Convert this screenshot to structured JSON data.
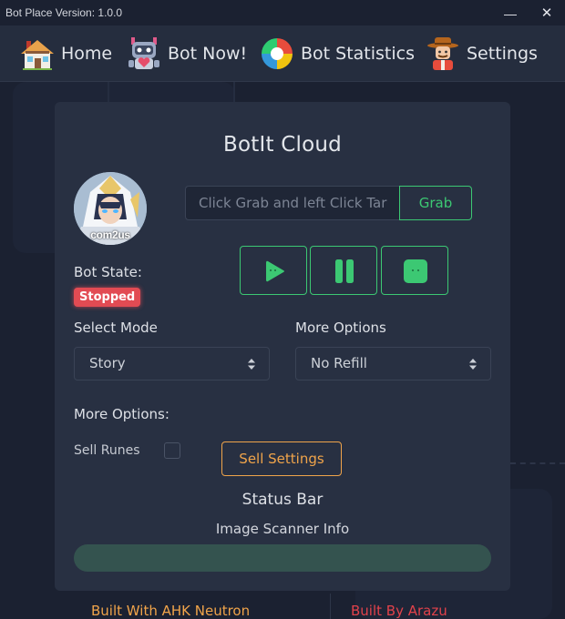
{
  "window": {
    "title": "Bot Place Version: 1.0.0",
    "minimize_glyph": "—",
    "close_glyph": "✕"
  },
  "nav": {
    "items": [
      {
        "label": "Home",
        "icon": "house-icon"
      },
      {
        "label": "Bot Now!",
        "icon": "robot-icon"
      },
      {
        "label": "Bot Statistics",
        "icon": "pie-chart-icon"
      },
      {
        "label": "Settings",
        "icon": "cowboy-avatar-icon"
      }
    ]
  },
  "card": {
    "title": "BotIt Cloud",
    "avatar_logo": "com2us",
    "target_input": {
      "placeholder": "Click Grab and left Click Target",
      "value": ""
    },
    "grab_label": "Grab",
    "controls": [
      "play",
      "pause",
      "stop"
    ],
    "bot_state_label": "Bot State:",
    "bot_state_value": "Stopped",
    "select_mode_label": "Select Mode",
    "select_mode_value": "Story",
    "more_options_label": "More Options",
    "more_options_value": "No Refill",
    "more_options_heading": "More Options:",
    "sell_runes_label": "Sell Runes",
    "sell_runes_checked": false,
    "sell_settings_label": "Sell Settings",
    "status_bar_title": "Status Bar",
    "image_scanner_info": "Image Scanner Info",
    "status_progress": 0
  },
  "footer": {
    "left": "Built With AHK Neutron",
    "right": "Built By Arazu"
  },
  "colors": {
    "accent_green": "#3cc873",
    "accent_orange": "#f0a44a",
    "stopped_red": "#e24b53",
    "footer_red": "#e2424b",
    "background": "#1b2131",
    "card": "#283042"
  }
}
